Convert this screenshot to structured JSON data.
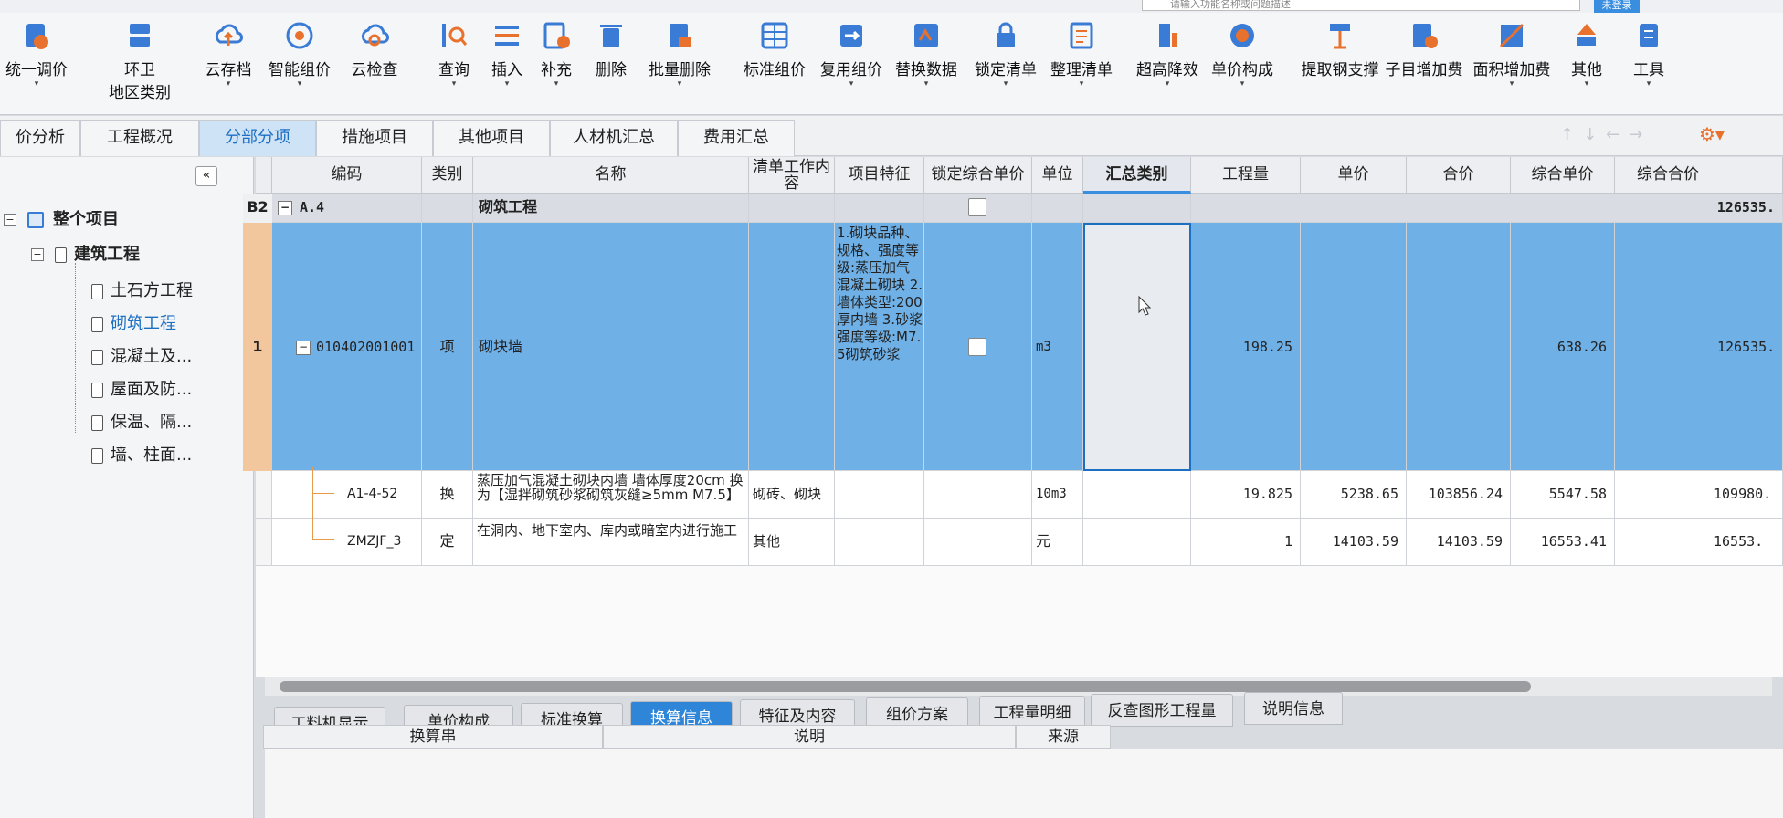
{
  "topbar": {
    "search_placeholder": "请输入功能名称或问题描述",
    "login_label": "未登录"
  },
  "toolbar": {
    "buttons": [
      {
        "label": "统一调价"
      },
      {
        "label": "环卫",
        "label2": "地区类别"
      },
      {
        "label": "云存档"
      },
      {
        "label": "智能组价"
      },
      {
        "label": "云检查"
      },
      {
        "label": "查询"
      },
      {
        "label": "插入"
      },
      {
        "label": "补充"
      },
      {
        "label": "删除"
      },
      {
        "label": "批量删除"
      },
      {
        "label": "标准组价"
      },
      {
        "label": "复用组价"
      },
      {
        "label": "替换数据"
      },
      {
        "label": "锁定清单"
      },
      {
        "label": "整理清单"
      },
      {
        "label": "超高降效"
      },
      {
        "label": "单价构成"
      },
      {
        "label": "提取钢支撑"
      },
      {
        "label": "子目增加费"
      },
      {
        "label": "面积增加费"
      },
      {
        "label": "其他"
      },
      {
        "label": "工具"
      }
    ]
  },
  "tabs": [
    "价分析",
    "工程概况",
    "分部分项",
    "措施项目",
    "其他项目",
    "人材机汇总",
    "费用汇总"
  ],
  "tree": {
    "root": "整个项目",
    "child": "建筑工程",
    "items": [
      "土石方工程",
      "砌筑工程",
      "混凝土及...",
      "屋面及防...",
      "保温、隔...",
      "墙、柱面..."
    ]
  },
  "grid": {
    "headers": {
      "code": "编码",
      "type": "类别",
      "name": "名称",
      "work": "清单工作内容",
      "feature": "项目特征",
      "lock": "锁定综合单价",
      "unit": "单位",
      "sumtype": "汇总类别",
      "qty": "工程量",
      "price": "单价",
      "total": "合价",
      "uprice": "综合单价",
      "utotal": "综合合价"
    },
    "section": {
      "num": "B2",
      "code": "A.4",
      "name": "砌筑工程",
      "utotal": "126535."
    },
    "item": {
      "num": "1",
      "code": "010402001001",
      "type": "项",
      "name": "砌块墙",
      "feature": "1.砌块品种、规格、强度等级:蒸压加气混凝土砌块 2.墙体类型:200厚内墙 3.砂浆强度等级:M7.5砌筑砂浆",
      "unit": "m3",
      "qty": "198.25",
      "uprice": "638.26",
      "utotal": "126535."
    },
    "sub1": {
      "code": "A1-4-52",
      "type": "换",
      "name": "蒸压加气混凝土砌块内墙 墙体厚度20cm  换为【湿拌砌筑砂浆砌筑灰缝≥5mm M7.5】",
      "work": "砌砖、砌块",
      "unit": "10m3",
      "qty": "19.825",
      "price": "5238.65",
      "total": "103856.24",
      "uprice": "5547.58",
      "utotal": "109980."
    },
    "sub2": {
      "code": "ZMZJF_3",
      "type": "定",
      "name": "在洞内、地下室内、库内或暗室内进行施工",
      "work": "其他",
      "unit": "元",
      "qty": "1",
      "price": "14103.59",
      "total": "14103.59",
      "uprice": "16553.41",
      "utotal": "16553."
    }
  },
  "bottom_tabs": [
    "工料机显示",
    "单价构成",
    "标准换算",
    "换算信息",
    "特征及内容",
    "组价方案",
    "工程量明细",
    "反查图形工程量",
    "说明信息"
  ],
  "bottom_headers": {
    "a": "换算串",
    "b": "说明",
    "c": "来源"
  },
  "colors": {
    "accent": "#2f86d8",
    "selection": "#6fb0e6"
  }
}
